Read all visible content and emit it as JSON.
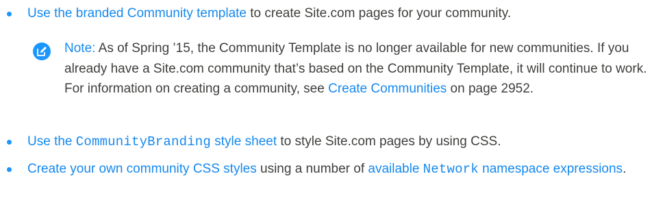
{
  "items": [
    {
      "link": "Use the branded Community template",
      "text": " to create Site.com pages for your community."
    },
    {
      "link_pre": "Use the ",
      "link_code": "CommunityBranding",
      "link_post": " style sheet",
      "text": " to style Site.com pages by using CSS."
    },
    {
      "link1": "Create your own community CSS styles",
      "text1": " using a number of ",
      "link2_pre": "available ",
      "link2_code": "Network",
      "link2_post": " namespace expressions",
      "text2": "."
    }
  ],
  "note": {
    "label": "Note:",
    "text_before": "  As of Spring ’15, the Community Template is no longer available for new communities. If you already have a Site.com community that’s based on the Community Template, it will continue to work. For information on creating a community, see ",
    "link": "Create Communities",
    "text_after": " on page 2952."
  },
  "icons": {
    "bullet": "bullet-dot",
    "note": "edit-pencil-icon"
  },
  "colors": {
    "link": "#1589ee",
    "bullet": "#1b96ff",
    "text": "#3e3e3c"
  }
}
